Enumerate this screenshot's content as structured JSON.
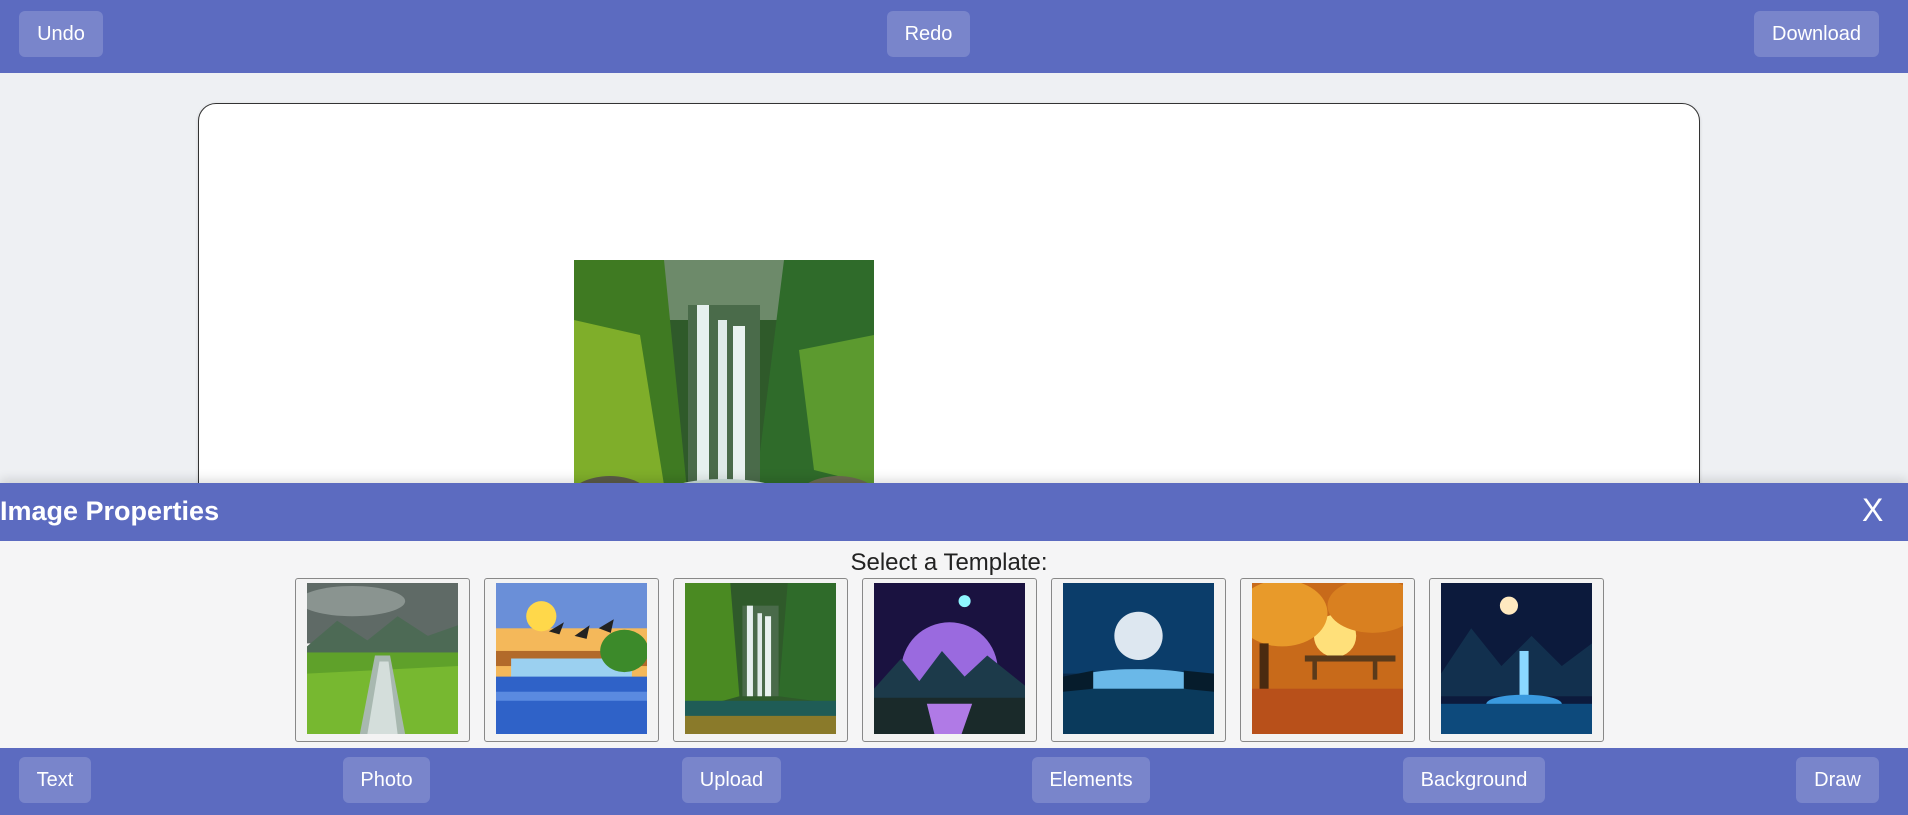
{
  "toolbar": {
    "undo": "Undo",
    "redo": "Redo",
    "download": "Download"
  },
  "panel": {
    "title": "Image Properties",
    "close": "X",
    "template_label": "Select a Template:",
    "templates": [
      "Rice field",
      "Waterfall painting",
      "Jungle waterfall",
      "Cosmic lake",
      "Moonlit sea",
      "Autumn bridge",
      "Night waterfall"
    ]
  },
  "bottombar": {
    "text": "Text",
    "photo": "Photo",
    "upload": "Upload",
    "elements": "Elements",
    "background": "Background",
    "draw": "Draw"
  },
  "colors": {
    "accent": "#5c6bc0"
  }
}
